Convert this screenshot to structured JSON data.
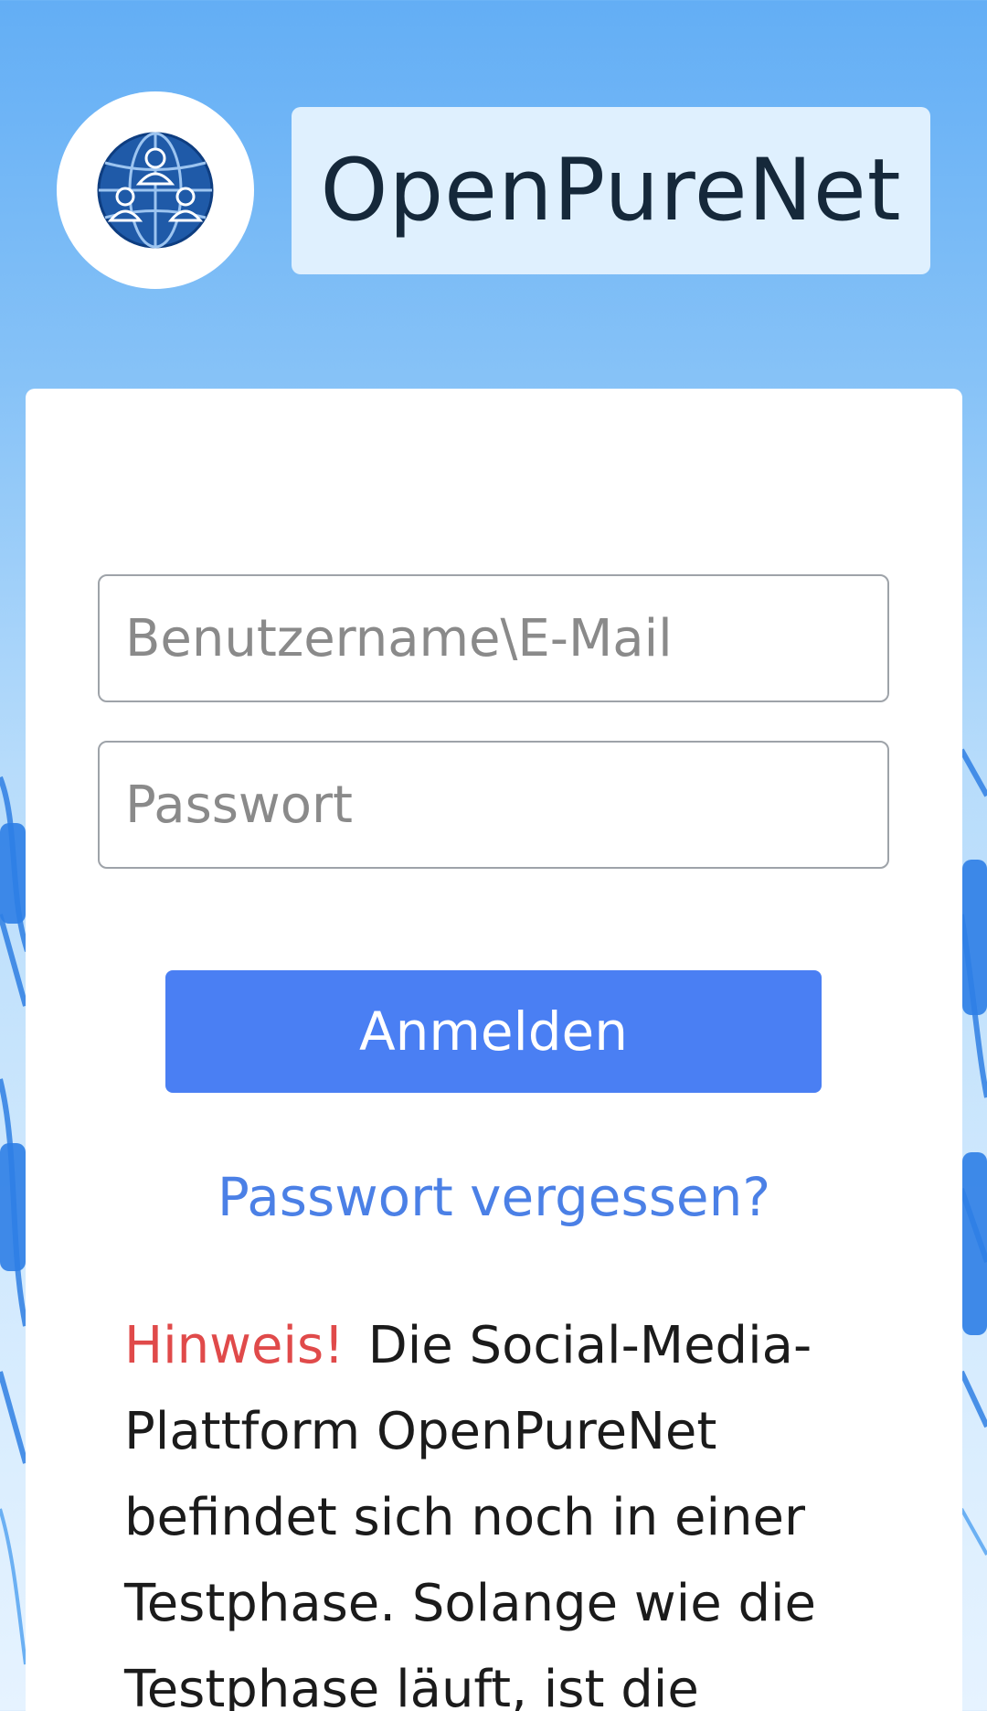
{
  "header": {
    "brand_name": "OpenPureNet",
    "logo_icon": "globe-people-icon"
  },
  "login_form": {
    "username_placeholder": "Benutzername\\E-Mail",
    "password_placeholder": "Passwort",
    "login_button_label": "Anmelden",
    "forgot_password_link": "Passwort vergessen?"
  },
  "notice": {
    "label": "Hinweis!",
    "text": "Die Social-Media-Plattform OpenPureNet befindet sich noch in einer Testphase. Solange wie die Testphase läuft, ist die"
  },
  "colors": {
    "background_top": "#63aef5",
    "brand_box": "#dff0fe",
    "primary_button": "#4a7ff3",
    "link": "#4b80e6",
    "notice_label": "#e04a4a"
  }
}
